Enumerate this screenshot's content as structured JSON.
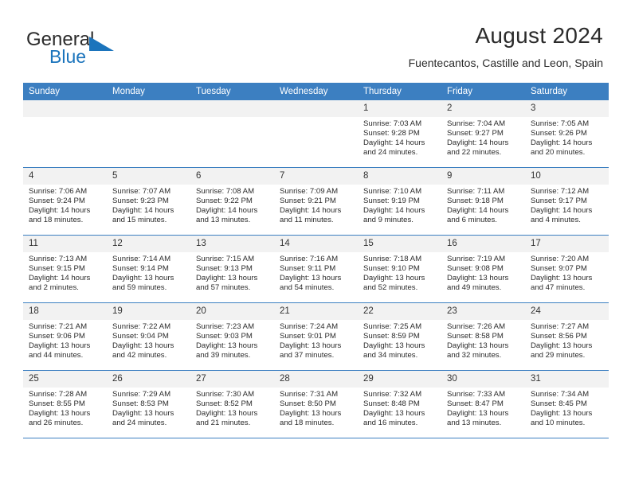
{
  "brand": {
    "word_one": "General",
    "word_two": "Blue",
    "logo_icon": "triangle-logo-icon",
    "accent_color": "#1b74bc"
  },
  "header": {
    "title": "August 2024",
    "location": "Fuentecantos, Castille and Leon, Spain",
    "header_bg_color": "#3c7fc1"
  },
  "calendar": {
    "weekday_headers": [
      "Sunday",
      "Monday",
      "Tuesday",
      "Wednesday",
      "Thursday",
      "Friday",
      "Saturday"
    ],
    "weeks": [
      [
        {
          "day": "",
          "blank": true,
          "sunrise": "",
          "sunset": "",
          "daylight_line1": "",
          "daylight_line2": ""
        },
        {
          "day": "",
          "blank": true,
          "sunrise": "",
          "sunset": "",
          "daylight_line1": "",
          "daylight_line2": ""
        },
        {
          "day": "",
          "blank": true,
          "sunrise": "",
          "sunset": "",
          "daylight_line1": "",
          "daylight_line2": ""
        },
        {
          "day": "",
          "blank": true,
          "sunrise": "",
          "sunset": "",
          "daylight_line1": "",
          "daylight_line2": ""
        },
        {
          "day": "1",
          "blank": false,
          "sunrise": "Sunrise: 7:03 AM",
          "sunset": "Sunset: 9:28 PM",
          "daylight_line1": "Daylight: 14 hours",
          "daylight_line2": "and 24 minutes."
        },
        {
          "day": "2",
          "blank": false,
          "sunrise": "Sunrise: 7:04 AM",
          "sunset": "Sunset: 9:27 PM",
          "daylight_line1": "Daylight: 14 hours",
          "daylight_line2": "and 22 minutes."
        },
        {
          "day": "3",
          "blank": false,
          "sunrise": "Sunrise: 7:05 AM",
          "sunset": "Sunset: 9:26 PM",
          "daylight_line1": "Daylight: 14 hours",
          "daylight_line2": "and 20 minutes."
        }
      ],
      [
        {
          "day": "4",
          "blank": false,
          "sunrise": "Sunrise: 7:06 AM",
          "sunset": "Sunset: 9:24 PM",
          "daylight_line1": "Daylight: 14 hours",
          "daylight_line2": "and 18 minutes."
        },
        {
          "day": "5",
          "blank": false,
          "sunrise": "Sunrise: 7:07 AM",
          "sunset": "Sunset: 9:23 PM",
          "daylight_line1": "Daylight: 14 hours",
          "daylight_line2": "and 15 minutes."
        },
        {
          "day": "6",
          "blank": false,
          "sunrise": "Sunrise: 7:08 AM",
          "sunset": "Sunset: 9:22 PM",
          "daylight_line1": "Daylight: 14 hours",
          "daylight_line2": "and 13 minutes."
        },
        {
          "day": "7",
          "blank": false,
          "sunrise": "Sunrise: 7:09 AM",
          "sunset": "Sunset: 9:21 PM",
          "daylight_line1": "Daylight: 14 hours",
          "daylight_line2": "and 11 minutes."
        },
        {
          "day": "8",
          "blank": false,
          "sunrise": "Sunrise: 7:10 AM",
          "sunset": "Sunset: 9:19 PM",
          "daylight_line1": "Daylight: 14 hours",
          "daylight_line2": "and 9 minutes."
        },
        {
          "day": "9",
          "blank": false,
          "sunrise": "Sunrise: 7:11 AM",
          "sunset": "Sunset: 9:18 PM",
          "daylight_line1": "Daylight: 14 hours",
          "daylight_line2": "and 6 minutes."
        },
        {
          "day": "10",
          "blank": false,
          "sunrise": "Sunrise: 7:12 AM",
          "sunset": "Sunset: 9:17 PM",
          "daylight_line1": "Daylight: 14 hours",
          "daylight_line2": "and 4 minutes."
        }
      ],
      [
        {
          "day": "11",
          "blank": false,
          "sunrise": "Sunrise: 7:13 AM",
          "sunset": "Sunset: 9:15 PM",
          "daylight_line1": "Daylight: 14 hours",
          "daylight_line2": "and 2 minutes."
        },
        {
          "day": "12",
          "blank": false,
          "sunrise": "Sunrise: 7:14 AM",
          "sunset": "Sunset: 9:14 PM",
          "daylight_line1": "Daylight: 13 hours",
          "daylight_line2": "and 59 minutes."
        },
        {
          "day": "13",
          "blank": false,
          "sunrise": "Sunrise: 7:15 AM",
          "sunset": "Sunset: 9:13 PM",
          "daylight_line1": "Daylight: 13 hours",
          "daylight_line2": "and 57 minutes."
        },
        {
          "day": "14",
          "blank": false,
          "sunrise": "Sunrise: 7:16 AM",
          "sunset": "Sunset: 9:11 PM",
          "daylight_line1": "Daylight: 13 hours",
          "daylight_line2": "and 54 minutes."
        },
        {
          "day": "15",
          "blank": false,
          "sunrise": "Sunrise: 7:18 AM",
          "sunset": "Sunset: 9:10 PM",
          "daylight_line1": "Daylight: 13 hours",
          "daylight_line2": "and 52 minutes."
        },
        {
          "day": "16",
          "blank": false,
          "sunrise": "Sunrise: 7:19 AM",
          "sunset": "Sunset: 9:08 PM",
          "daylight_line1": "Daylight: 13 hours",
          "daylight_line2": "and 49 minutes."
        },
        {
          "day": "17",
          "blank": false,
          "sunrise": "Sunrise: 7:20 AM",
          "sunset": "Sunset: 9:07 PM",
          "daylight_line1": "Daylight: 13 hours",
          "daylight_line2": "and 47 minutes."
        }
      ],
      [
        {
          "day": "18",
          "blank": false,
          "sunrise": "Sunrise: 7:21 AM",
          "sunset": "Sunset: 9:06 PM",
          "daylight_line1": "Daylight: 13 hours",
          "daylight_line2": "and 44 minutes."
        },
        {
          "day": "19",
          "blank": false,
          "sunrise": "Sunrise: 7:22 AM",
          "sunset": "Sunset: 9:04 PM",
          "daylight_line1": "Daylight: 13 hours",
          "daylight_line2": "and 42 minutes."
        },
        {
          "day": "20",
          "blank": false,
          "sunrise": "Sunrise: 7:23 AM",
          "sunset": "Sunset: 9:03 PM",
          "daylight_line1": "Daylight: 13 hours",
          "daylight_line2": "and 39 minutes."
        },
        {
          "day": "21",
          "blank": false,
          "sunrise": "Sunrise: 7:24 AM",
          "sunset": "Sunset: 9:01 PM",
          "daylight_line1": "Daylight: 13 hours",
          "daylight_line2": "and 37 minutes."
        },
        {
          "day": "22",
          "blank": false,
          "sunrise": "Sunrise: 7:25 AM",
          "sunset": "Sunset: 8:59 PM",
          "daylight_line1": "Daylight: 13 hours",
          "daylight_line2": "and 34 minutes."
        },
        {
          "day": "23",
          "blank": false,
          "sunrise": "Sunrise: 7:26 AM",
          "sunset": "Sunset: 8:58 PM",
          "daylight_line1": "Daylight: 13 hours",
          "daylight_line2": "and 32 minutes."
        },
        {
          "day": "24",
          "blank": false,
          "sunrise": "Sunrise: 7:27 AM",
          "sunset": "Sunset: 8:56 PM",
          "daylight_line1": "Daylight: 13 hours",
          "daylight_line2": "and 29 minutes."
        }
      ],
      [
        {
          "day": "25",
          "blank": false,
          "sunrise": "Sunrise: 7:28 AM",
          "sunset": "Sunset: 8:55 PM",
          "daylight_line1": "Daylight: 13 hours",
          "daylight_line2": "and 26 minutes."
        },
        {
          "day": "26",
          "blank": false,
          "sunrise": "Sunrise: 7:29 AM",
          "sunset": "Sunset: 8:53 PM",
          "daylight_line1": "Daylight: 13 hours",
          "daylight_line2": "and 24 minutes."
        },
        {
          "day": "27",
          "blank": false,
          "sunrise": "Sunrise: 7:30 AM",
          "sunset": "Sunset: 8:52 PM",
          "daylight_line1": "Daylight: 13 hours",
          "daylight_line2": "and 21 minutes."
        },
        {
          "day": "28",
          "blank": false,
          "sunrise": "Sunrise: 7:31 AM",
          "sunset": "Sunset: 8:50 PM",
          "daylight_line1": "Daylight: 13 hours",
          "daylight_line2": "and 18 minutes."
        },
        {
          "day": "29",
          "blank": false,
          "sunrise": "Sunrise: 7:32 AM",
          "sunset": "Sunset: 8:48 PM",
          "daylight_line1": "Daylight: 13 hours",
          "daylight_line2": "and 16 minutes."
        },
        {
          "day": "30",
          "blank": false,
          "sunrise": "Sunrise: 7:33 AM",
          "sunset": "Sunset: 8:47 PM",
          "daylight_line1": "Daylight: 13 hours",
          "daylight_line2": "and 13 minutes."
        },
        {
          "day": "31",
          "blank": false,
          "sunrise": "Sunrise: 7:34 AM",
          "sunset": "Sunset: 8:45 PM",
          "daylight_line1": "Daylight: 13 hours",
          "daylight_line2": "and 10 minutes."
        }
      ]
    ]
  }
}
